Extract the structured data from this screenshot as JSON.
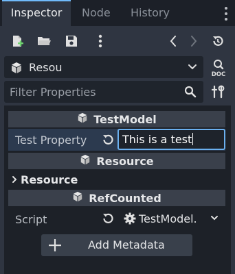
{
  "tabs": [
    {
      "label": "Inspector",
      "active": true
    },
    {
      "label": "Node",
      "active": false
    },
    {
      "label": "History",
      "active": false
    }
  ],
  "toolbar": {
    "icons": [
      "new-resource-icon",
      "open-folder-icon",
      "save-icon",
      "more-icon",
      "back-icon",
      "forward-icon",
      "history-icon"
    ]
  },
  "resource_selector": {
    "value": "Resou",
    "icon": "cube-icon"
  },
  "doc_button": {
    "label": "DOC"
  },
  "filter": {
    "placeholder": "Filter Properties"
  },
  "inspector": {
    "sections": [
      {
        "title": "TestModel"
      },
      {
        "title": "Resource"
      },
      {
        "title": "RefCounted"
      }
    ],
    "test_property": {
      "label": "Test Property",
      "value": "This is a test"
    },
    "resource_group": {
      "label": "Resource",
      "collapsed": true
    },
    "script": {
      "label": "Script",
      "value": "TestModel."
    },
    "add_metadata": {
      "label": "Add Metadata"
    }
  },
  "colors": {
    "accent": "#70bafa",
    "panel": "#2f3541",
    "background": "#21262e",
    "section_header": "#3a404b",
    "edit_highlight": "#2c3a4f"
  }
}
